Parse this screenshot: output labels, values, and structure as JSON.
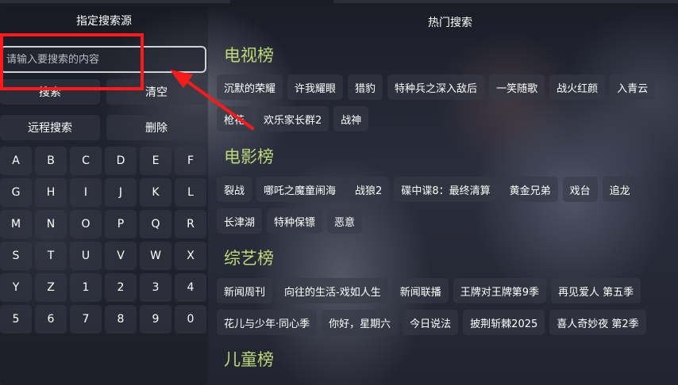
{
  "left_panel": {
    "source_title": "指定搜索源",
    "search_placeholder": "请输入要搜索的内容",
    "search_value": "",
    "buttons": {
      "search": "搜索",
      "clear": "清空",
      "remote_search": "远程搜索",
      "delete": "删除"
    },
    "keys": [
      "A",
      "B",
      "C",
      "D",
      "E",
      "F",
      "G",
      "H",
      "I",
      "J",
      "K",
      "L",
      "M",
      "N",
      "O",
      "P",
      "Q",
      "R",
      "S",
      "T",
      "U",
      "V",
      "W",
      "X",
      "Y",
      "Z",
      "1",
      "2",
      "3",
      "4",
      "5",
      "6",
      "7",
      "8",
      "9",
      "0"
    ]
  },
  "hot_search": {
    "title": "热门搜索",
    "sections": [
      {
        "title": "电视榜",
        "items": [
          "沉默的荣耀",
          "许我耀眼",
          "猎豹",
          "特种兵之深入敌后",
          "一笑随歌",
          "战火红颜",
          "入青云",
          "枪花",
          "欢乐家长群2",
          "战神"
        ]
      },
      {
        "title": "电影榜",
        "items": [
          "裂战",
          "哪吒之魔童闹海",
          "战狼2",
          "碟中谍8：最终清算",
          "黄金兄弟",
          "戏台",
          "追龙",
          "长津湖",
          "特种保镖",
          "恶意"
        ]
      },
      {
        "title": "综艺榜",
        "items": [
          "新闻周刊",
          "向往的生活-戏如人生",
          "新闻联播",
          "王牌对王牌第9季",
          "再见爱人 第五季",
          "花儿与少年·同心季",
          "你好，星期六",
          "今日说法",
          "披荆斩棘2025",
          "喜人奇妙夜 第2季"
        ]
      },
      {
        "title": "儿童榜",
        "items": []
      }
    ]
  },
  "annotation": {
    "highlight_color": "#ff1a1a"
  }
}
